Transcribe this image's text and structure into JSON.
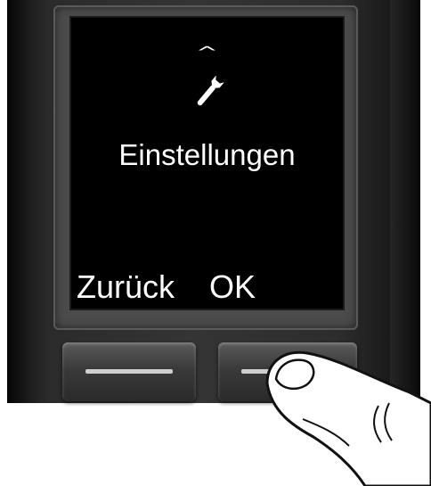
{
  "display": {
    "scroll_indicator": "^",
    "menu_icon": "wrench-icon",
    "menu_label": "Einstellungen",
    "softkey_left": "Zurück",
    "softkey_right": "OK"
  },
  "colors": {
    "screen_background": "#000000",
    "screen_text": "#ffffff",
    "handset_body": "#2f2f2f"
  }
}
